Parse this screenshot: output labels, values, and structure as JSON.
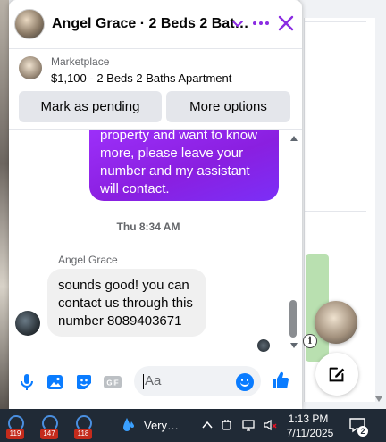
{
  "header": {
    "title": "Angel Grace · 2 Beds 2 Bat…"
  },
  "listing": {
    "source": "Marketplace",
    "title": "$1,100 - 2 Beds 2 Baths Apartment",
    "mark_pending_label": "Mark as pending",
    "more_options_label": "More options"
  },
  "messages": {
    "outgoing_text": "property and want to know more, please leave your number and my assistant will contact.",
    "timestamp": "Thu 8:34 AM",
    "sender_name": "Angel Grace",
    "incoming_text": "sounds good! you can contact us through this number 8089403671"
  },
  "composer": {
    "placeholder": "Aa",
    "icons": [
      "microphone-icon",
      "photo-icon",
      "sticker-icon",
      "gif-icon",
      "emoji-icon",
      "thumbs-up-icon"
    ],
    "gif_label": "GIF"
  },
  "taskbar": {
    "apps": [
      {
        "badge": "119"
      },
      {
        "badge": "147"
      },
      {
        "badge": "118"
      }
    ],
    "weather_label": "Very…",
    "time": "1:13 PM",
    "date": "7/11/2025",
    "notification_count": "2"
  },
  "colors": {
    "accent": "#8a2be2",
    "messenger_blue": "#0a7cff",
    "outgoing_bubble": "#9b2ff0",
    "taskbar_bg": "#202a36",
    "badge_red": "#c42b1c"
  }
}
